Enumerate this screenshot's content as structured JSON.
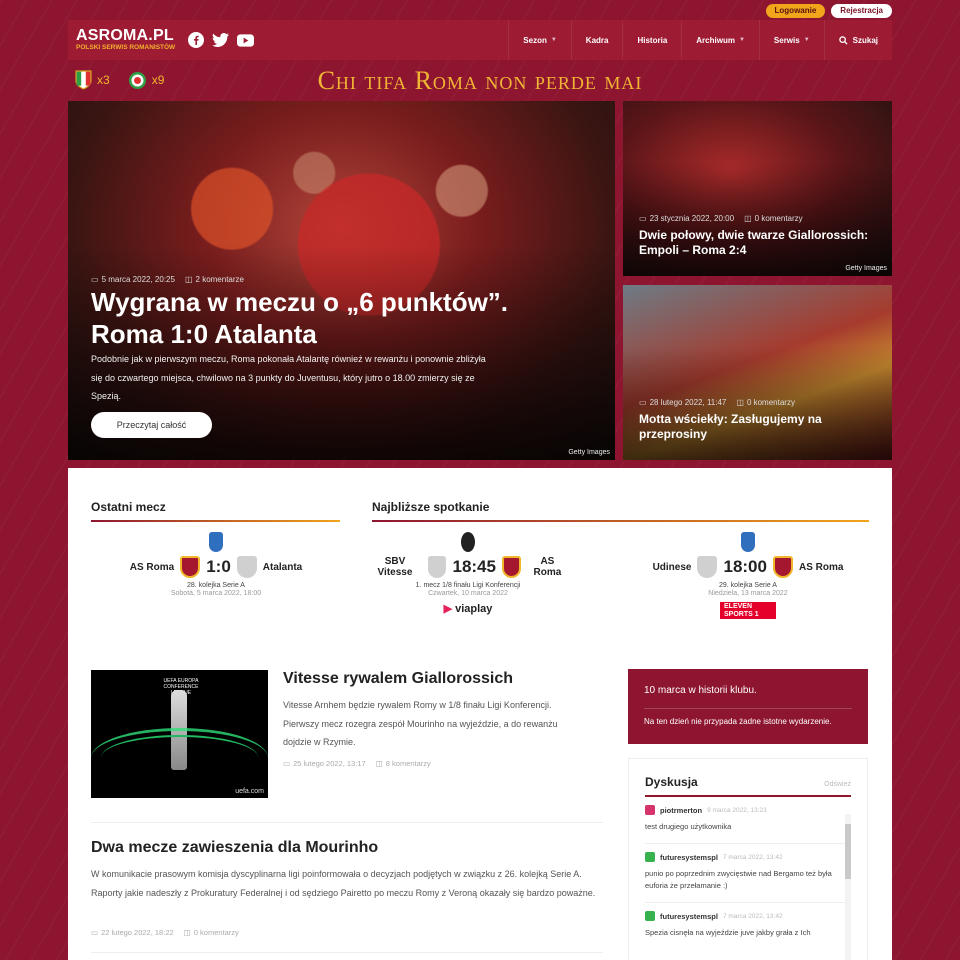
{
  "auth": {
    "login": "Logowanie",
    "register": "Rejestracja"
  },
  "logo": {
    "name": "ASROMA.PL",
    "tagline": "POLSKI SERWIS ROMANISTÓW"
  },
  "social": [
    "facebook-icon",
    "twitter-icon",
    "youtube-icon"
  ],
  "menu": [
    {
      "label": "Sezon",
      "dropdown": true
    },
    {
      "label": "Kadra",
      "dropdown": false
    },
    {
      "label": "Historia",
      "dropdown": false
    },
    {
      "label": "Archiwum",
      "dropdown": true
    },
    {
      "label": "Serwis",
      "dropdown": true
    },
    {
      "label": "Szukaj",
      "dropdown": false
    }
  ],
  "trophies": [
    {
      "icon": "scudetto-icon",
      "count": "x3"
    },
    {
      "icon": "coppa-italia-icon",
      "count": "x9"
    }
  ],
  "motto": "Chi tifa Roma non perde mai",
  "hero": {
    "date": "5 marca 2022, 20:25",
    "comments": "2 komentarze",
    "title": "Wygrana w meczu o „6 punktów”. Roma 1:0 Atalanta",
    "lead": "Podobnie jak w pierwszym meczu, Roma pokonała Atalantę również w rewanżu i ponownie zbliżyła się do czwartego miejsca, chwilowo na 3 punkty do Juventusu, który jutro o 18.00 zmierzy się ze Spezią.",
    "button": "Przeczytaj całość",
    "credit": "Getty Images"
  },
  "side_articles": [
    {
      "date": "23 stycznia 2022, 20:00",
      "comments": "0 komentarzy",
      "title": "Dwie połowy, dwie twarze Giallorossich: Empoli – Roma 2:4",
      "credit": "Getty Images"
    },
    {
      "date": "28 lutego 2022, 11:47",
      "comments": "0 komentarzy",
      "title": "Motta wściekły: Zasługujemy na przeprosiny"
    }
  ],
  "last_match": {
    "header": "Ostatni mecz",
    "home": "AS Roma",
    "away": "Atalanta",
    "score": "1:0",
    "info": "28. kolejka Serie A",
    "date": "Sobota, 5 marca 2022, 18:00"
  },
  "next_header": "Najbliższe spotkanie",
  "next_matches": [
    {
      "home": "SBV Vitesse",
      "away": "AS Roma",
      "time": "18:45",
      "info": "1. mecz 1/8 finału Ligi Konferencji",
      "date": "Czwartek, 10 marca 2022",
      "broadcast": "viaplay"
    },
    {
      "home": "Udinese",
      "away": "AS Roma",
      "time": "18:00",
      "info": "29. kolejka Serie A",
      "date": "Niedziela, 13 marca 2022",
      "broadcast": "ELEVEN SPORTS 1"
    }
  ],
  "articles": [
    {
      "title": "Vitesse rywalem Giallorossich",
      "body": "Vitesse Arnhem będzie rywalem Romy w 1/8 finału Ligi Konferencji. Pierwszy mecz rozegra zespół Mourinho na wyjeździe, a do rewanżu dojdzie w Rzymie.",
      "date": "25 lutego 2022, 13:17",
      "comments": "8 komentarzy",
      "image_credit": "uefa.com",
      "image_label": "UEFA EUROPA CONFERENCE LEAGUE"
    },
    {
      "title": "Dwa mecze zawieszenia dla Mourinho",
      "body": "W komunikacie prasowym komisja dyscyplinarna ligi poinformowała o decyzjach podjętych w związku z 26. kolejką Serie A. Raporty jakie nadeszły z Prokuratury Federalnej i od sędziego Pairetto po meczu Romy z Veroną okazały się bardzo poważne.",
      "date": "22 lutego 2022, 18:22",
      "comments": "0 komentarzy"
    }
  ],
  "history": {
    "title": "10 marca w historii klubu.",
    "text": "Na ten dzień nie przypada żadne istotne wydarzenie."
  },
  "discussion": {
    "title": "Dyskusja",
    "refresh": "Odśwież",
    "comments": [
      {
        "user": "piotrmerton",
        "time": "9 marca 2022, 13:23",
        "text": "test drugiego użytkownika",
        "avatar_color": "#d6336c"
      },
      {
        "user": "futuresystemspl",
        "time": "7 marca 2022, 13:42",
        "text": "punio po poprzednim zwycięstwie nad Bergamo też była euforia że przełamanie :)",
        "avatar_color": "#37b24d"
      },
      {
        "user": "futuresystemspl",
        "time": "7 marca 2022, 13:42",
        "text": "Spezia cisnęła na wyjeździe juve jakby grała z Ich",
        "avatar_color": "#37b24d"
      }
    ]
  }
}
